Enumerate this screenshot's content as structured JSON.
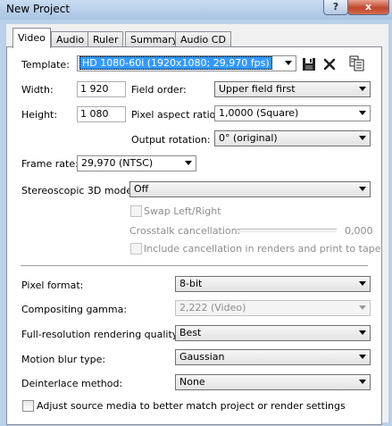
{
  "window": {
    "title": "New Project",
    "help_glyph": "?",
    "close_glyph": "x"
  },
  "tabs": [
    {
      "label": "Video"
    },
    {
      "label": "Audio"
    },
    {
      "label": "Ruler"
    },
    {
      "label": "Summary"
    },
    {
      "label": "Audio CD"
    }
  ],
  "template": {
    "label": "Template:",
    "value": "HD 1080-60i (1920x1080; 29,970 fps)",
    "icons": [
      "save-icon",
      "delete-icon",
      "match-media-icon"
    ]
  },
  "width": {
    "label": "Width:",
    "value": "1 920"
  },
  "height": {
    "label": "Height:",
    "value": "1 080"
  },
  "field_order": {
    "label": "Field order:",
    "value": "Upper field first"
  },
  "pixel_aspect": {
    "label": "Pixel aspect ratio:",
    "value": "1,0000 (Square)"
  },
  "output_rotation": {
    "label": "Output rotation:",
    "value": "0° (original)"
  },
  "frame_rate": {
    "label": "Frame rate:",
    "value": "29,970 (NTSC)"
  },
  "stereo": {
    "label": "Stereoscopic 3D mode:",
    "value": "Off",
    "swap_label": "Swap Left/Right",
    "crosstalk_label": "Crosstalk cancellation:",
    "crosstalk_value": "0,000",
    "include_label": "Include cancellation in renders and print to tape"
  },
  "pixel_format": {
    "label": "Pixel format:",
    "value": "8-bit"
  },
  "compositing_gamma": {
    "label": "Compositing gamma:",
    "value": "2,222 (Video)"
  },
  "render_quality": {
    "label": "Full-resolution rendering quality:",
    "value": "Best"
  },
  "motion_blur": {
    "label": "Motion blur type:",
    "value": "Gaussian"
  },
  "deinterlace": {
    "label": "Deinterlace method:",
    "value": "None"
  },
  "adjust_source": {
    "label": "Adjust source media to better match project or render settings",
    "checked": false
  },
  "colors": {
    "selection": "#3399ff",
    "disabled_text": "#8d8d8d",
    "border": "#898c95"
  }
}
